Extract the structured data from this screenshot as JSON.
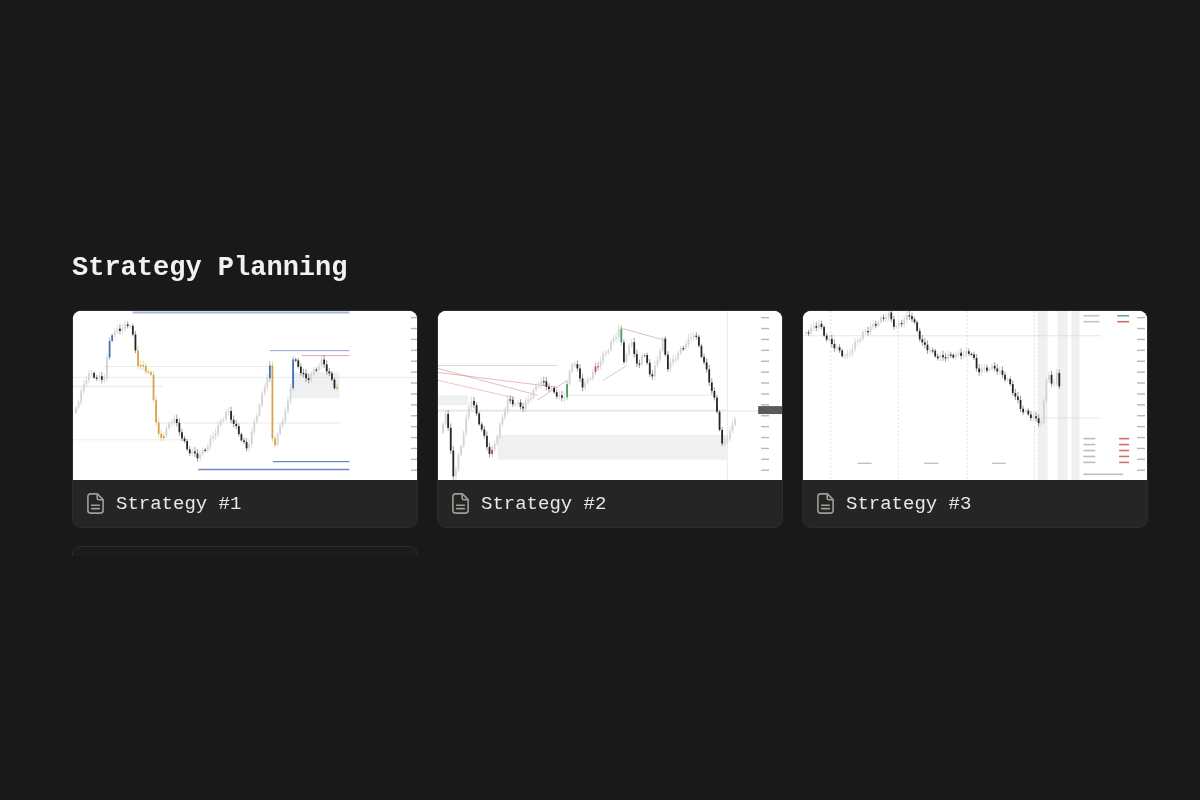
{
  "gallery": {
    "title": "Strategy Planning",
    "cards": [
      {
        "title": "Strategy #1",
        "thumbnail": {
          "kind": "candlestick-chart"
        }
      },
      {
        "title": "Strategy #2",
        "thumbnail": {
          "kind": "candlestick-chart"
        }
      },
      {
        "title": "Strategy #3",
        "thumbnail": {
          "kind": "candlestick-chart"
        }
      }
    ],
    "next_row_cut_off": true
  }
}
